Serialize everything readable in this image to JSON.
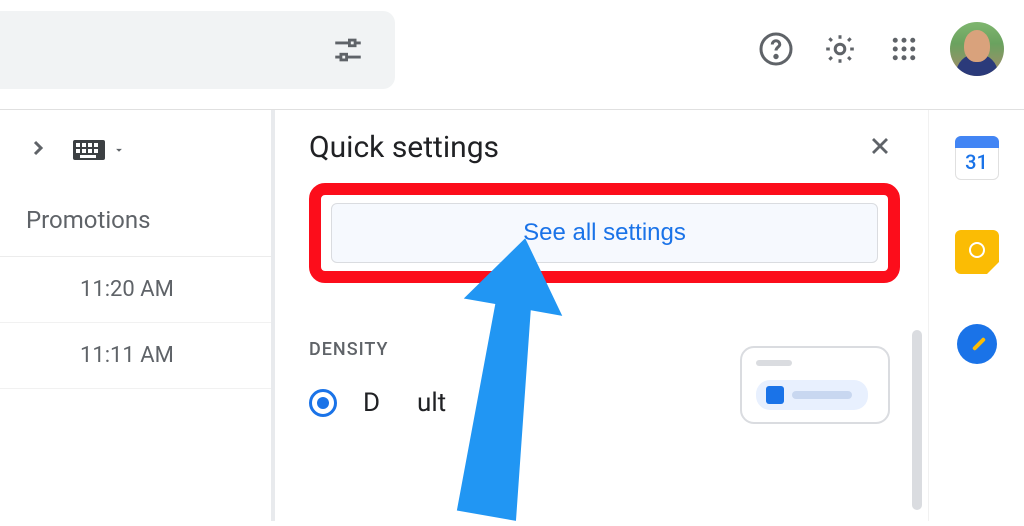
{
  "header": {
    "tune_icon": "tune",
    "help_icon": "help",
    "settings_icon": "settings",
    "apps_icon": "apps",
    "avatar": "user-avatar"
  },
  "inbox": {
    "tab_label": "Promotions",
    "times": [
      "11:20 AM",
      "11:11 AM"
    ]
  },
  "panel": {
    "title": "Quick settings",
    "close": "close",
    "see_all": "See all settings",
    "density_heading": "DENSITY",
    "density_options": [
      "Default"
    ]
  },
  "rail": {
    "calendar_day": "31"
  },
  "highlight_color": "#fc0d1b",
  "accent_color": "#1a73e8"
}
